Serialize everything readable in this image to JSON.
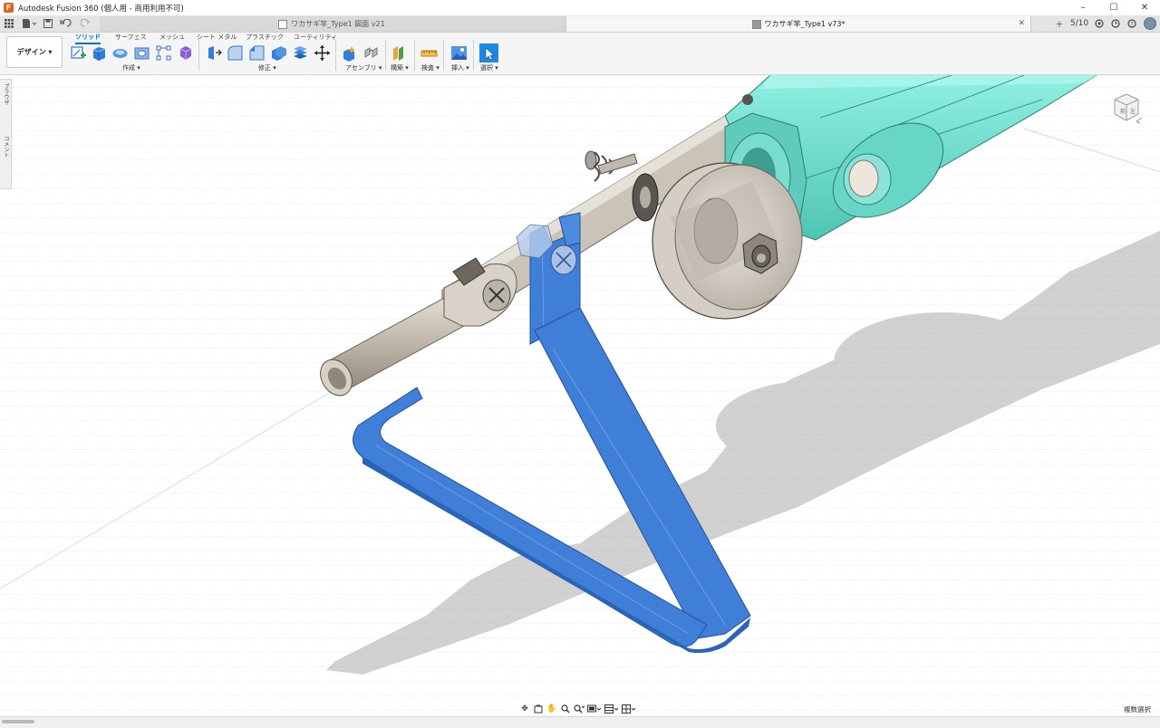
{
  "window": {
    "title": "Autodesk Fusion 360 (個人用 - 商用利用不可)",
    "logo_letter": "F",
    "controls": {
      "minimize": "–",
      "maximize": "☐",
      "close": "✕"
    }
  },
  "tabs": [
    {
      "label": "ワカサギ竿_Type1 図面 v21",
      "active": false
    },
    {
      "label": "ワカサギ竿_Type1 v73*",
      "active": true
    }
  ],
  "tabbar_right": {
    "job_status": "5/10"
  },
  "ribbon": {
    "workspace_label": "デザイン ▾",
    "tabs": [
      "ソリッド",
      "サーフェス",
      "メッシュ",
      "シート メタル",
      "プラスチック",
      "ユーティリティ"
    ],
    "active_tab": "ソリッド",
    "groups": [
      {
        "label": "作成 ▾"
      },
      {
        "label": "修正 ▾"
      },
      {
        "label": "アセンブリ ▾"
      },
      {
        "label": "構築 ▾"
      },
      {
        "label": "検査 ▾"
      },
      {
        "label": "挿入 ▾"
      },
      {
        "label": "選択 ▾"
      }
    ]
  },
  "side_panel": {
    "browser_label": "ブラウザ",
    "comments_label": "コメント"
  },
  "viewcube": {
    "face_front": "前",
    "face_left": "左"
  },
  "status": {
    "multi_select": "複数選択"
  },
  "colors": {
    "selection_blue": "#3f7fd8",
    "teal_part": "#6fdccd",
    "accent_blue": "#0b6fd1"
  }
}
